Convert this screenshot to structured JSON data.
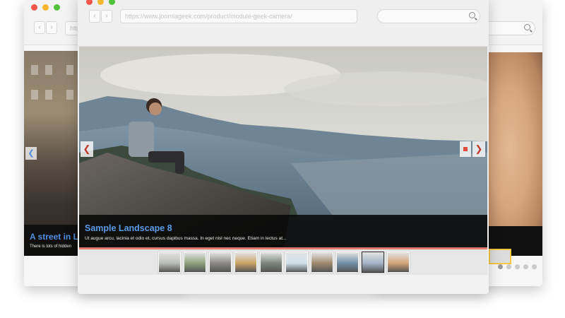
{
  "left_window": {
    "url": "http",
    "caption_title": "A street in L",
    "caption_text": "There is lots of hidden",
    "prev_label": "❮"
  },
  "main_window": {
    "url": "https://www.joomlageek.com/product/module-geek-camera/",
    "slide": {
      "title": "Sample Landscape 8",
      "text": "Ut augue arcu, lacinia et odio et, cursus dapibus massa. In eget nisl nec neque. Etiam in lectus at...",
      "prev_label": "❮",
      "next_label": "❯"
    },
    "thumbnails": [
      {
        "name": "thumb-1",
        "color": "#b9bcb6"
      },
      {
        "name": "thumb-2",
        "color": "#8fa27c"
      },
      {
        "name": "thumb-3",
        "color": "#8c8a86"
      },
      {
        "name": "thumb-4",
        "color": "#c9a466"
      },
      {
        "name": "thumb-5",
        "color": "#7a857c"
      },
      {
        "name": "thumb-6",
        "color": "#cfe0ea"
      },
      {
        "name": "thumb-7",
        "color": "#a18a6e"
      },
      {
        "name": "thumb-8",
        "color": "#6f8fa6"
      },
      {
        "name": "thumb-9",
        "color": "#a4b3c6"
      },
      {
        "name": "thumb-10",
        "color": "#d4a476"
      }
    ],
    "active_thumbnail": 8
  },
  "right_window": {
    "page_dots": 5,
    "active_dot": 0
  },
  "colors": {
    "caption_title": "#5a9be6",
    "accent_line": "#e07a6e",
    "close": "#f2554b",
    "minimize": "#f5b731",
    "maximize": "#52c23d"
  }
}
